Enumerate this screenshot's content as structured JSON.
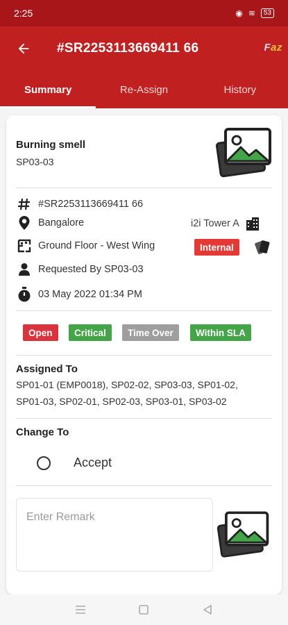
{
  "status_bar": {
    "time": "2:25",
    "battery": "53"
  },
  "app_bar": {
    "title": "#SR2253113669411 66",
    "logo_a": "F",
    "logo_b": "az"
  },
  "tabs": [
    {
      "label": "Summary",
      "active": true
    },
    {
      "label": "Re-Assign",
      "active": false
    },
    {
      "label": "History",
      "active": false
    }
  ],
  "issue": {
    "title": "Burning smell",
    "code": "SP03-03"
  },
  "details": {
    "ticket_id": "#SR2253113669411 66",
    "city": "Bangalore",
    "building": "i2i Tower A",
    "location": "Ground Floor - West Wing",
    "type_badge": "Internal",
    "requested_by": "Requested By SP03-03",
    "datetime": "03 May 2022 01:34 PM"
  },
  "status_badges": [
    {
      "label": "Open",
      "color": "#d9343d"
    },
    {
      "label": "Critical",
      "color": "#43a547"
    },
    {
      "label": "Time Over",
      "color": "#9e9e9e"
    },
    {
      "label": "Within SLA",
      "color": "#43a547"
    }
  ],
  "assigned": {
    "title": "Assigned To",
    "line1": "SP01-01 (EMP0018), SP02-02, SP03-03, SP01-02,",
    "line2": "SP01-03, SP02-01, SP02-03, SP03-01, SP03-02"
  },
  "change_to": {
    "title": "Change To",
    "option": "Accept"
  },
  "remark": {
    "placeholder": "Enter Remark"
  },
  "colors": {
    "brand": "#c0201f",
    "status_bar": "#a8161a"
  },
  "icons": [
    "back-arrow-icon",
    "hash-icon",
    "location-pin-icon",
    "building-icon",
    "floor-plan-icon",
    "person-icon",
    "stopwatch-icon",
    "image-gallery-icon",
    "tag-icon"
  ]
}
